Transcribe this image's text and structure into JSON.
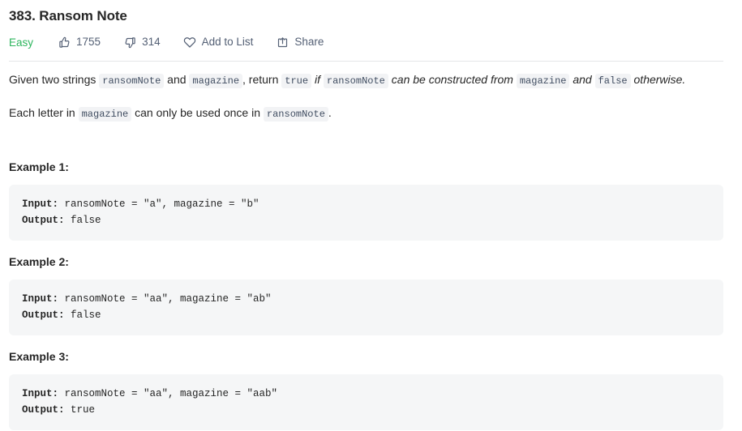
{
  "problem": {
    "title": "383. Ransom Note",
    "difficulty": "Easy",
    "likes": "1755",
    "dislikes": "314",
    "add_to_list_label": "Add to List",
    "share_label": "Share",
    "icons": {
      "like": "thumbs-up-icon",
      "dislike": "thumbs-down-icon",
      "add_to_list": "heart-icon",
      "share": "share-icon"
    }
  },
  "description": {
    "paragraph1": {
      "t1": "Given two strings ",
      "c1": "ransomNote",
      "t2": " and ",
      "c2": "magazine",
      "t3": ", return ",
      "c3": "true",
      "t4": " ",
      "i1": "if",
      "t5": " ",
      "c4": "ransomNote",
      "t6": " ",
      "i2": "can be constructed from",
      "t7": " ",
      "c5": "magazine",
      "t8": " ",
      "i3": "and",
      "t9": " ",
      "c6": "false",
      "t10": " ",
      "i4": "otherwise."
    },
    "paragraph2": {
      "t1": "Each letter in ",
      "c1": "magazine",
      "t2": " can only be used once in ",
      "c2": "ransomNote",
      "t3": "."
    }
  },
  "examples": [
    {
      "heading": "Example 1:",
      "input_label": "Input:",
      "input_value": " ransomNote = \"a\", magazine = \"b\"",
      "output_label": "Output:",
      "output_value": " false"
    },
    {
      "heading": "Example 2:",
      "input_label": "Input:",
      "input_value": " ransomNote = \"aa\", magazine = \"ab\"",
      "output_label": "Output:",
      "output_value": " false"
    },
    {
      "heading": "Example 3:",
      "input_label": "Input:",
      "input_value": " ransomNote = \"aa\", magazine = \"aab\"",
      "output_label": "Output:",
      "output_value": " true"
    }
  ],
  "colors": {
    "easy_green": "#2db55d",
    "meta_text": "#546075",
    "code_bg": "#f5f6f7",
    "chip_bg": "#f2f3f5",
    "divider": "#e5e6e8",
    "text": "#262626"
  }
}
